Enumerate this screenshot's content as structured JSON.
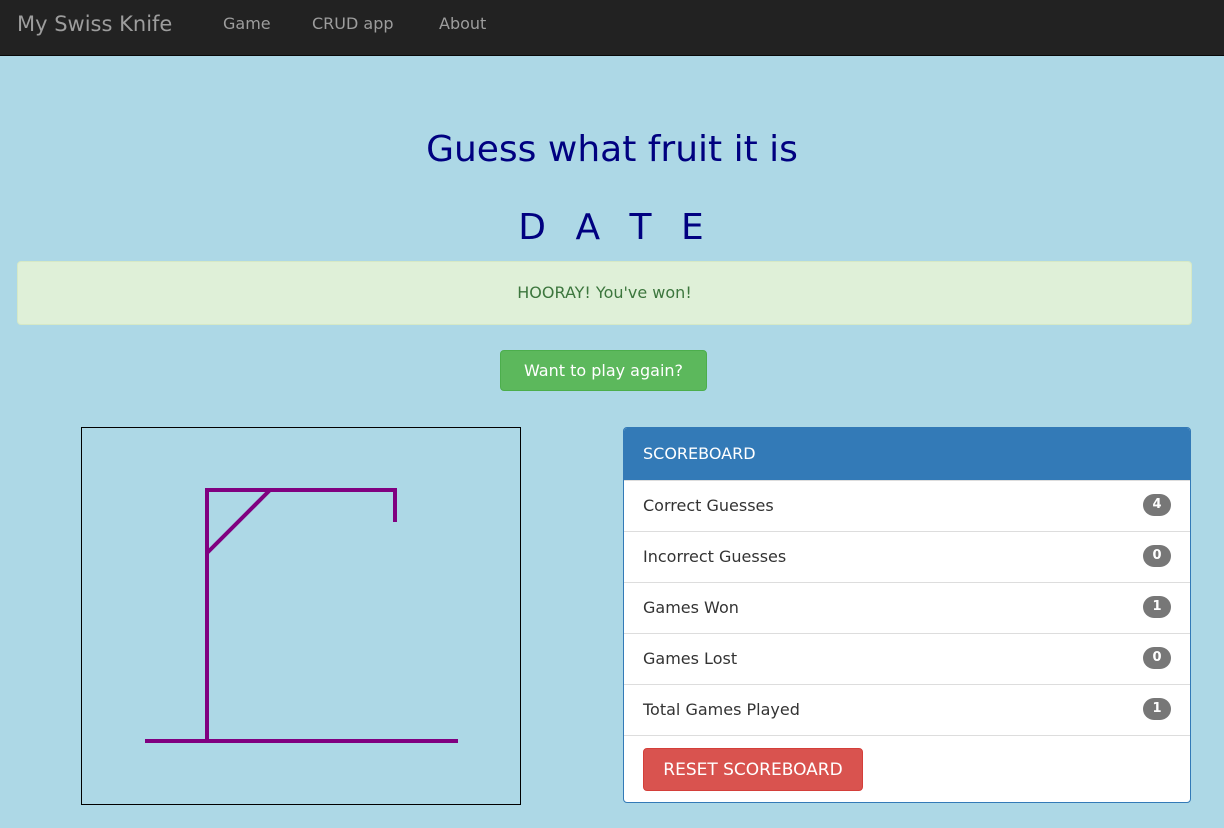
{
  "navbar": {
    "brand": "My Swiss Knife",
    "links": [
      "Game",
      "CRUD app",
      "About"
    ]
  },
  "game": {
    "title": "Guess what fruit it is",
    "letters": [
      "D",
      "A",
      "T",
      "E"
    ],
    "alert": "HOORAY! You've won!",
    "play_again": "Want to play again?"
  },
  "scoreboard": {
    "heading": "SCOREBOARD",
    "rows": [
      {
        "label": "Correct Guesses",
        "value": "4"
      },
      {
        "label": "Incorrect Guesses",
        "value": "0"
      },
      {
        "label": "Games Won",
        "value": "1"
      },
      {
        "label": "Games Lost",
        "value": "0"
      },
      {
        "label": "Total Games Played",
        "value": "1"
      }
    ],
    "reset": "RESET SCOREBOARD"
  },
  "colors": {
    "background": "#add8e6",
    "navbar": "#222222",
    "title": "#000080",
    "gallows": "#800080",
    "success": "#5cb85c",
    "primary": "#337ab7",
    "danger": "#d9534f"
  },
  "hangman": {
    "incorrect_guesses": 0
  }
}
